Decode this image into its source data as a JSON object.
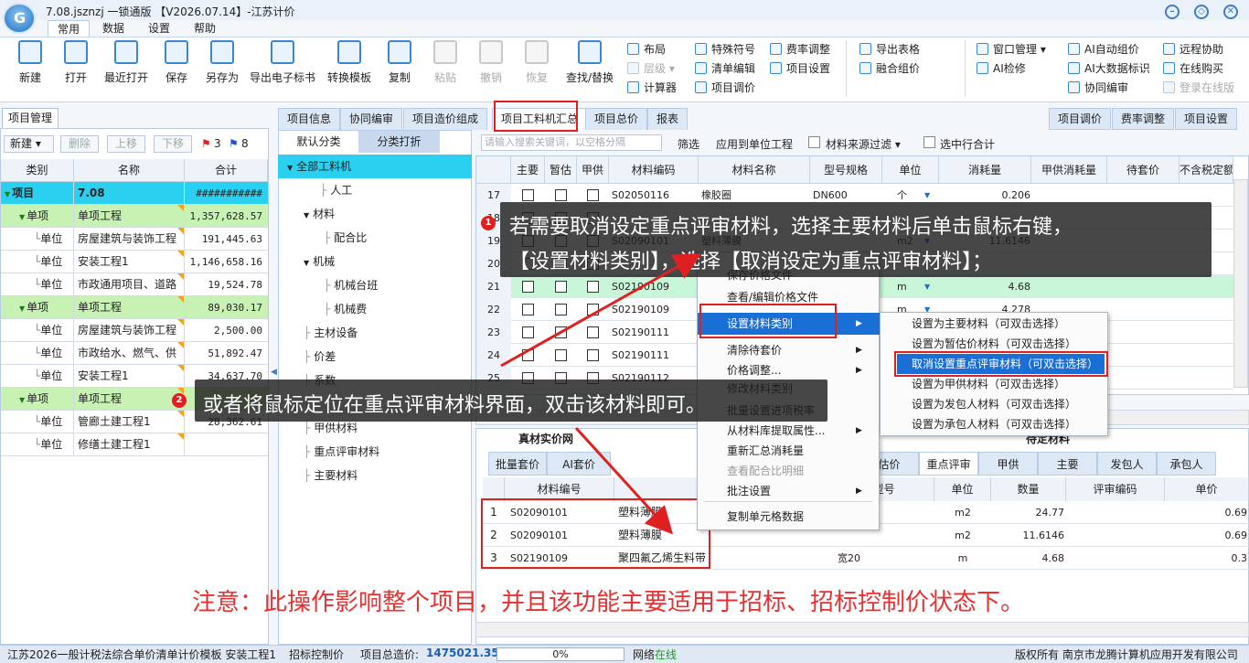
{
  "app": {
    "title": "7.08.jsznzj 一锁通版 【V2026.07.14】-江苏计价",
    "menu_tabs": [
      "常用",
      "数据",
      "设置",
      "帮助"
    ],
    "active_menu_tab": "常用"
  },
  "ribbon": {
    "big_buttons": [
      "新建",
      "打开",
      "最近打开",
      "保存",
      "另存为",
      "导出电子标书",
      "转换模板",
      "复制",
      "粘贴",
      "撤销",
      "恢复",
      "查找/替换"
    ],
    "small_col1": [
      "布局",
      "层级",
      "计算器"
    ],
    "small_col2": [
      "特殊符号",
      "清单编辑",
      "项目调价"
    ],
    "small_col3": [
      "费率调整",
      "项目设置"
    ],
    "small_col4": [
      "导出表格",
      "融合组价"
    ],
    "small_col5": [
      "窗口管理",
      "AI检修"
    ],
    "small_col6": [
      "AI自动组价",
      "AI大数据标识",
      "协同编审"
    ],
    "small_col7": [
      "远程协助",
      "在线购买",
      "登录在线版"
    ]
  },
  "left_panel": {
    "tab": "项目管理",
    "toolbar": {
      "new": "新建",
      "delete": "删除",
      "up": "上移",
      "down": "下移",
      "red_flag_count": "3",
      "blue_flag_count": "8"
    },
    "columns": [
      "类别",
      "名称",
      "合计"
    ],
    "rows": [
      {
        "type": "项目",
        "name": "7.08",
        "total": "###########",
        "style": "top"
      },
      {
        "type": "单项",
        "name": "单项工程",
        "total": "1,357,628.57",
        "style": "grp"
      },
      {
        "type": "单位",
        "name": "房屋建筑与装饰工程",
        "total": "191,445.63",
        "style": ""
      },
      {
        "type": "单位",
        "name": "安装工程1",
        "total": "1,146,658.16",
        "style": ""
      },
      {
        "type": "单位",
        "name": "市政通用项目、道路",
        "total": "19,524.78",
        "style": ""
      },
      {
        "type": "单项",
        "name": "单项工程",
        "total": "89,030.17",
        "style": "grp"
      },
      {
        "type": "单位",
        "name": "房屋建筑与装饰工程",
        "total": "2,500.00",
        "style": ""
      },
      {
        "type": "单位",
        "name": "市政给水、燃气、供",
        "total": "51,892.47",
        "style": ""
      },
      {
        "type": "单位",
        "name": "安装工程1",
        "total": "34,637.70",
        "style": ""
      },
      {
        "type": "单项",
        "name": "单项工程",
        "total": "",
        "style": "grp"
      },
      {
        "type": "单位",
        "name": "管廊土建工程1",
        "total": "28,362.61",
        "style": ""
      },
      {
        "type": "单位",
        "name": "修缮土建工程1",
        "total": "",
        "style": ""
      }
    ]
  },
  "top_tabs": [
    "项目信息",
    "协同编审",
    "项目造价组成",
    "项目工料机汇总",
    "项目总价",
    "报表"
  ],
  "active_top_tab": "项目工料机汇总",
  "right_tabs": [
    "项目调价",
    "费率调整",
    "项目设置"
  ],
  "category_panel": {
    "headers": [
      "默认分类",
      "分类打折"
    ],
    "items": [
      "全部工料机",
      "人工",
      "材料",
      "配合比",
      "机械",
      "机械台班",
      "机械费",
      "主材设备",
      "价差",
      "系数",
      "",
      "甲供材料",
      "重点评审材料",
      "主要材料"
    ]
  },
  "filter_bar": {
    "search_placeholder": "请输入搜索关键词，以空格分隔",
    "filter": "筛选",
    "apply_unit": "应用到单位工程",
    "source_filter": "材料来源过滤",
    "select_row_total": "选中行合计"
  },
  "main_grid": {
    "columns": [
      "主要",
      "暂估",
      "甲供",
      "材料编码",
      "材料名称",
      "型号规格",
      "单位",
      "消耗量",
      "甲供消耗量",
      "待套价",
      "不含税定额"
    ],
    "rows": [
      {
        "no": "17",
        "code": "S02050116",
        "name": "橡胶圈",
        "spec": "DN600",
        "unit": "个",
        "qty": "0.206"
      },
      {
        "no": "18",
        "code": "",
        "name": "",
        "spec": "",
        "unit": "",
        "qty": ""
      },
      {
        "no": "19",
        "code": "S02090101",
        "name": "塑料薄膜",
        "spec": "",
        "unit": "m2",
        "qty": "11.6146"
      },
      {
        "no": "20",
        "code": "",
        "name": "",
        "spec": "",
        "unit": "",
        "qty": ""
      },
      {
        "no": "21",
        "code": "S02190109",
        "name": "",
        "spec": "",
        "unit": "m",
        "qty": "4.68"
      },
      {
        "no": "22",
        "code": "S02190109",
        "name": "",
        "spec": "",
        "unit": "m",
        "qty": "4.278"
      },
      {
        "no": "23",
        "code": "S02190111",
        "name": "",
        "spec": "",
        "unit": "",
        "qty": ""
      },
      {
        "no": "24",
        "code": "S02190111",
        "name": "",
        "spec": "",
        "unit": "",
        "qty": ""
      },
      {
        "no": "25",
        "code": "S02190112",
        "name": "",
        "spec": "",
        "unit": "",
        "qty": ""
      }
    ]
  },
  "context_menu": {
    "items": [
      "保存价格文件",
      "查看/编辑价格文件",
      "设置材料类别",
      "清除待套价",
      "价格调整...",
      "修改材料类别",
      "批量设置进项税率",
      "从材料库提取属性...",
      "重新汇总消耗量",
      "查看配合比明细",
      "批注设置",
      "复制单元格数据"
    ],
    "submenu": [
      "设置为主要材料（可双击选择）",
      "设置为暂估价材料（可双击选择）",
      "取消设置重点评审材料（可双击选择）",
      "设置为甲供材料（可双击选择）",
      "设置为发包人材料（可双击选择）",
      "设置为承包人材料（可双击选择）"
    ]
  },
  "bottom": {
    "left_title": "真材实价网",
    "right_title": "待定材料",
    "tabs": [
      "批量套价",
      "AI套价",
      "估价",
      "重点评审",
      "甲供",
      "主要",
      "发包人",
      "承包人"
    ],
    "columns": [
      "材料编号",
      "型号",
      "单位",
      "数量",
      "评审编码",
      "单价"
    ],
    "rows": [
      {
        "no": "1",
        "code": "S02090101",
        "name": "塑料薄膜",
        "spec": "",
        "unit": "m2",
        "qty": "24.77",
        "price": "0.69"
      },
      {
        "no": "2",
        "code": "S02090101",
        "name": "塑料薄膜",
        "spec": "",
        "unit": "m2",
        "qty": "11.6146",
        "price": "0.69"
      },
      {
        "no": "3",
        "code": "S02190109",
        "name": "聚四氟乙烯生料带",
        "spec": "宽20",
        "unit": "m",
        "qty": "4.68",
        "price": "0.3"
      }
    ]
  },
  "annotations": {
    "callout1_badge": "1",
    "callout1_line1": "若需要取消设定重点评审材料，选择主要材料后单击鼠标右键，",
    "callout1_line2": "【设置材料类别】，选择【取消设定为重点评审材料】；",
    "callout2_badge": "2",
    "callout2_text": "或者将鼠标定位在重点评审材料界面，双击该材料即可。",
    "note": "注意：此操作影响整个项目，并且该功能主要适用于招标、招标控制价状态下。",
    "colors": {
      "red": "#e02020",
      "callout_bg": "#1e1e1e",
      "highlight_blue": "#1a6fd6"
    }
  },
  "status_bar": {
    "template": "江苏2026一般计税法综合单价清单计价模板 安装工程1",
    "mode": "招标控制价",
    "total_label": "项目总造价:",
    "total_value": "1475021.35",
    "progress": "0%",
    "network_label": "网络",
    "network_status": "在线",
    "copyright": "版权所有 南京市龙腾计算机应用开发有限公司"
  }
}
